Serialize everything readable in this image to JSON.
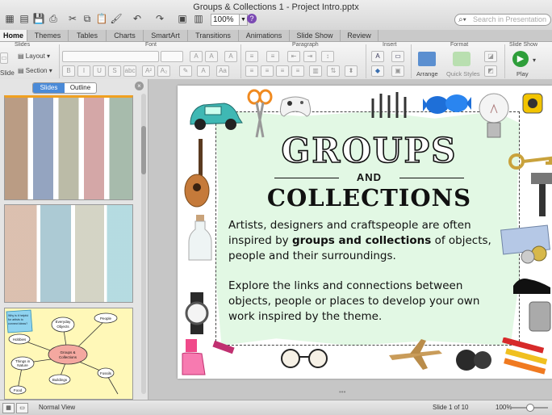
{
  "window": {
    "title": "Groups & Collections 1 - Project Intro.pptx",
    "zoom": "100%",
    "search_placeholder": "Search in Presentation"
  },
  "tabs": [
    "Home",
    "Themes",
    "Tables",
    "Charts",
    "SmartArt",
    "Transitions",
    "Animations",
    "Slide Show",
    "Review"
  ],
  "active_tab": "Home",
  "ribbon": {
    "groups": [
      "Slides",
      "Font",
      "Paragraph",
      "Insert",
      "Format",
      "Slide Show"
    ],
    "layout_label": "Layout",
    "section_label": "Section",
    "slide_label": "Slide",
    "arrange_label": "Arrange",
    "quick_styles_label": "Quick Styles",
    "play_label": "Play"
  },
  "pane": {
    "tab_slides": "Slides",
    "tab_outline": "Outline"
  },
  "thumbnails": {
    "mind_map": {
      "center": "Groups & Collections",
      "nodes": [
        "People",
        "Everyday Objects",
        "Hobbies",
        "Buildings",
        "Food",
        "Things in Nature",
        "Fossils"
      ],
      "note": "Why is it helpful for artists to connect ideas?"
    }
  },
  "slide": {
    "title_line1": "GROUPS",
    "title_line2": "AND",
    "title_line3": "COLLECTIONS",
    "body_part1": "Artists, designers and craftspeople are often inspired by ",
    "body_bold": "groups and collections",
    "body_part2": " of objects, people and their surroundings.",
    "body_para2": "Explore the links and connections between objects, people or places to develop your own work inspired by the theme."
  },
  "status": {
    "view": "Normal View",
    "slide_indicator": "Slide 1 of 10",
    "zoom": "100%"
  },
  "colors": {
    "accent": "#4a8ad8",
    "green_panel": "#e2f8e4",
    "play_green": "#2e9e3a",
    "help_purple": "#7b4ab3"
  }
}
